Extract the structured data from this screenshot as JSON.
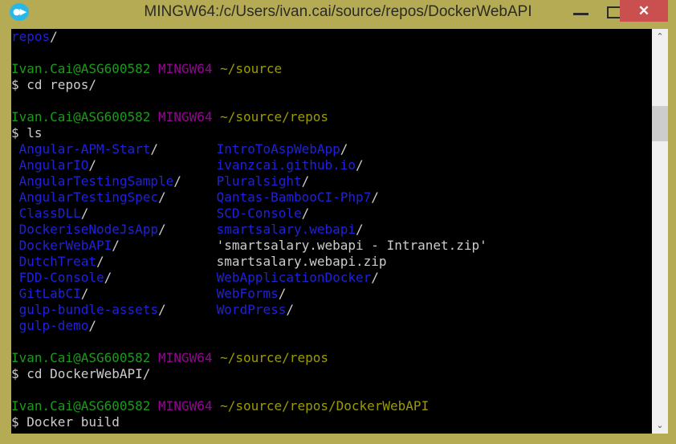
{
  "window": {
    "title": "MINGW64:/c/Users/ivan.cai/source/repos/DockerWebAPI",
    "app_icon": "mingw-terminal-icon",
    "border_color": "#b5ab55",
    "background_color": "#000000",
    "controls": {
      "minimize_label": "—",
      "maximize_label": "□",
      "close_label": "✕",
      "close_color": "#c9504f"
    }
  },
  "colors": {
    "user_host": "#1a9b1a",
    "shell_name": "#9b009b",
    "path": "#9b9b00",
    "directory": "#2020dd",
    "file": "#cccccc"
  },
  "scrollbar": {
    "up_arrow": "⌃",
    "down_arrow": "⌄",
    "thumb_position_percent": 18
  },
  "terminal": {
    "lines": [
      {
        "type": "output-dir",
        "dir": "repos",
        "slash": "/"
      },
      {
        "type": "blank"
      },
      {
        "type": "prompt",
        "user": "Ivan.Cai@ASG600582",
        "shell": "MINGW64",
        "path": "~/source"
      },
      {
        "type": "command",
        "sigil": "$",
        "text": " cd repos/"
      },
      {
        "type": "blank"
      },
      {
        "type": "prompt",
        "user": "Ivan.Cai@ASG600582",
        "shell": "MINGW64",
        "path": "~/source/repos"
      },
      {
        "type": "command",
        "sigil": "$",
        "text": " ls"
      }
    ],
    "listing": [
      {
        "left": {
          "name": "Angular-APM-Start",
          "kind": "dir"
        },
        "right": {
          "name": "IntroToAspWebApp",
          "kind": "dir"
        }
      },
      {
        "left": {
          "name": "AngularIO",
          "kind": "dir"
        },
        "right": {
          "name": "ivanzcai.github.io",
          "kind": "dir"
        }
      },
      {
        "left": {
          "name": "AngularTestingSample",
          "kind": "dir"
        },
        "right": {
          "name": "Pluralsight",
          "kind": "dir"
        }
      },
      {
        "left": {
          "name": "AngularTestingSpec",
          "kind": "dir"
        },
        "right": {
          "name": "Qantas-BambooCI-Php7",
          "kind": "dir"
        }
      },
      {
        "left": {
          "name": "ClassDLL",
          "kind": "dir"
        },
        "right": {
          "name": "SCD-Console",
          "kind": "dir"
        }
      },
      {
        "left": {
          "name": "DockeriseNodeJsApp",
          "kind": "dir"
        },
        "right": {
          "name": "smartsalary.webapi",
          "kind": "dir"
        }
      },
      {
        "left": {
          "name": "DockerWebAPI",
          "kind": "dir"
        },
        "right": {
          "name": "'smartsalary.webapi - Intranet.zip'",
          "kind": "file"
        }
      },
      {
        "left": {
          "name": "DutchTreat",
          "kind": "dir"
        },
        "right": {
          "name": "smartsalary.webapi.zip",
          "kind": "file"
        }
      },
      {
        "left": {
          "name": "FDD-Console",
          "kind": "dir"
        },
        "right": {
          "name": "WebApplicationDocker",
          "kind": "dir"
        }
      },
      {
        "left": {
          "name": "GitLabCI",
          "kind": "dir"
        },
        "right": {
          "name": "WebForms",
          "kind": "dir"
        }
      },
      {
        "left": {
          "name": "gulp-bundle-assets",
          "kind": "dir"
        },
        "right": {
          "name": "WordPress",
          "kind": "dir"
        }
      },
      {
        "left": {
          "name": "gulp-demo",
          "kind": "dir"
        },
        "right": null
      }
    ],
    "trailing": [
      {
        "type": "blank"
      },
      {
        "type": "prompt",
        "user": "Ivan.Cai@ASG600582",
        "shell": "MINGW64",
        "path": "~/source/repos"
      },
      {
        "type": "command",
        "sigil": "$",
        "text": " cd DockerWebAPI/"
      },
      {
        "type": "blank"
      },
      {
        "type": "prompt",
        "user": "Ivan.Cai@ASG600582",
        "shell": "MINGW64",
        "path": "~/source/repos/DockerWebAPI"
      },
      {
        "type": "command",
        "sigil": "$",
        "text": " Docker build"
      }
    ]
  }
}
